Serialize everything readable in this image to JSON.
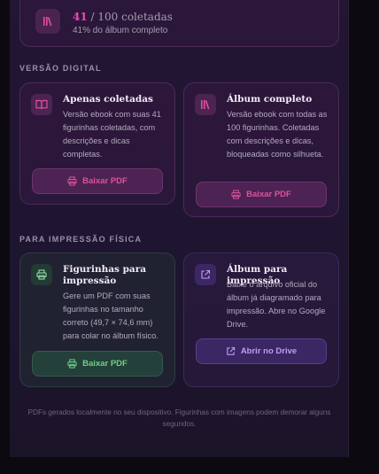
{
  "progress": {
    "count": "41",
    "total": " / 100 coletadas",
    "subtitle": "41% do álbum completo",
    "icon": "books-icon"
  },
  "sections": {
    "digital_title": "VERSÃO DIGITAL",
    "print_title": "PARA IMPRESSÃO FÍSICA"
  },
  "cards": {
    "collected": {
      "title": "Apenas coletadas",
      "description": "Versão ebook com suas 41 figurinhas coletadas, com descrições e dicas completas.",
      "button": "Baixar PDF",
      "icon": "book-open-icon"
    },
    "complete": {
      "title": "Álbum completo",
      "description": "Versão ebook com todas as 100 figurinhas. Coletadas com descrições e dicas, bloqueadas como silhueta.",
      "button": "Baixar PDF",
      "icon": "books-icon"
    },
    "stickers_print": {
      "title": "Figurinhas para impressão",
      "description": "Gere um PDF com suas figurinhas no tamanho correto (49,7 × 74,6 mm) para colar no álbum físico.",
      "button": "Baixar PDF",
      "icon": "printer-icon"
    },
    "album_print": {
      "title": "Álbum para impressão",
      "description": "Baixe o arquivo oficial do álbum já diagramado para impressão. Abre no Google Drive.",
      "button": "Abrir no Drive",
      "icon": "external-link-icon"
    }
  },
  "footer": {
    "note": "PDFs gerados localmente no seu dispositivo. Figurinhas com imagens podem demorar alguns segundos."
  },
  "colors": {
    "accent_pink": "#e0509f",
    "accent_green": "#6fcf8b",
    "accent_violet": "#c39cf3"
  }
}
